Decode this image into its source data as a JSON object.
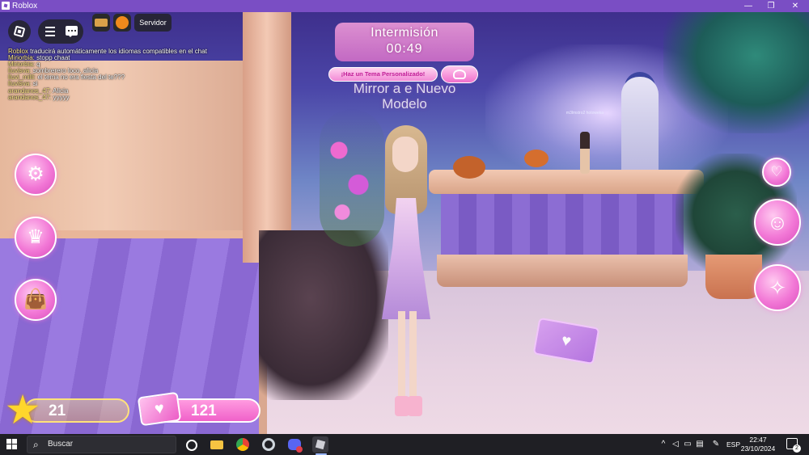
{
  "window": {
    "title": "Roblox",
    "controls": {
      "minimize": "—",
      "restore": "❐",
      "close": "✕"
    }
  },
  "hud": {
    "server_button": "Servidor",
    "intermission": {
      "label": "Intermisión",
      "timer": "00:49"
    },
    "theme_button": "¡Haz un Tema Personalizado!",
    "theme_name": "Mirror a e Nuevo Modelo",
    "npc_label": "m3lmstro2 hotoweka",
    "stars": "21",
    "money": "121"
  },
  "chat": [
    {
      "name": "Roblox",
      "text": "traducirá automáticamente los idiomas compatibles en el chat"
    },
    {
      "name": "Miriorbia:",
      "text": "stopp chaat"
    },
    {
      "name": "Miriorbia:",
      "text": "q"
    },
    {
      "name": "lluvisva:",
      "text": "sombrerero loco, alicia"
    },
    {
      "name": "lluvi_milli:",
      "text": "el tema no era fiesta del te???"
    },
    {
      "name": "lluvisva:",
      "text": "si"
    },
    {
      "name": "arandanos_47:",
      "text": "Alicia"
    },
    {
      "name": "arandanos_47:",
      "text": "yyyyy"
    }
  ],
  "taskbar": {
    "search_placeholder": "Buscar",
    "language": "ESP",
    "time": "22:47",
    "date": "23/10/2024",
    "notification_count": "2"
  },
  "icons": {
    "roblox_menu": "roblox-logo-icon",
    "hamburger": "hamburger-icon",
    "chat": "chat-icon",
    "customize": "gears-icon",
    "vip": "vip-trophy-icon",
    "shop": "shopping-bag-icon",
    "outfit": "heels-icon",
    "profile": "avatar-face-icon",
    "emotes": "dance-pose-icon",
    "star": "star-icon",
    "money": "pink-cash-icon"
  },
  "colors": {
    "title_bar": "#7a4ec4",
    "hud_pink": "#f278d6",
    "star_yellow": "#ffd62c",
    "taskbar": "#1f1f24"
  }
}
